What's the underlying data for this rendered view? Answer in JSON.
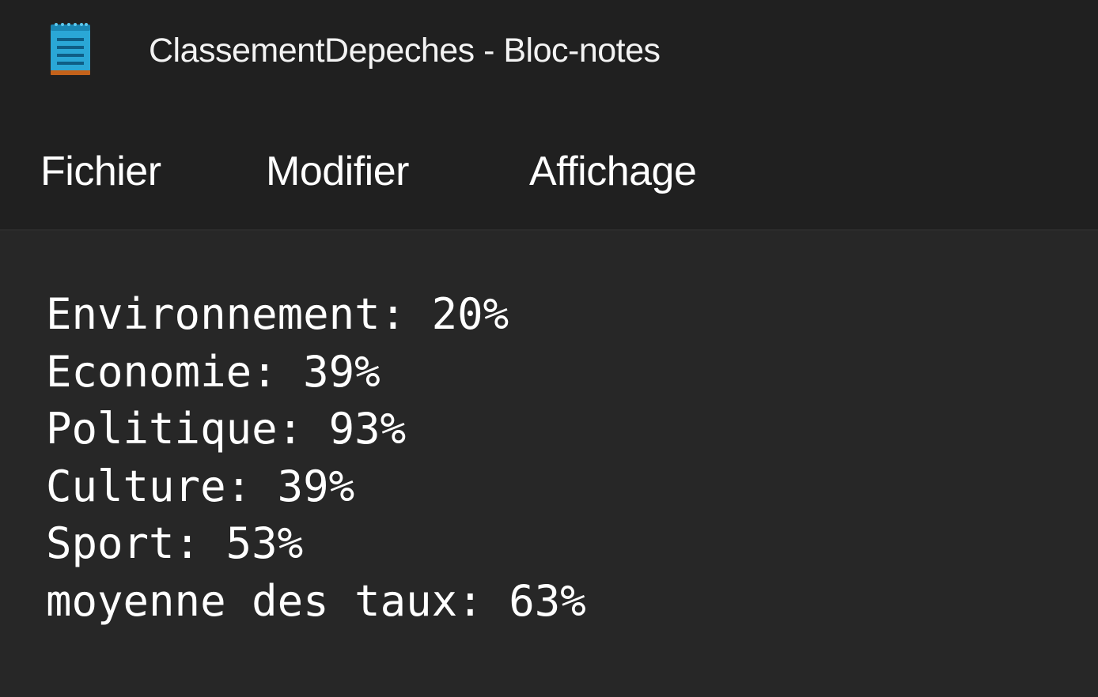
{
  "window": {
    "title": "ClassementDepeches - Bloc-notes",
    "app_icon": "notepad-icon"
  },
  "menu": {
    "items": [
      {
        "label": "Fichier"
      },
      {
        "label": "Modifier"
      },
      {
        "label": "Affichage"
      }
    ]
  },
  "document": {
    "lines": [
      "Environnement: 20%",
      "Economie: 39%",
      "Politique: 93%",
      "Culture: 39%",
      "Sport: 53%",
      "moyenne des taux: 63%"
    ]
  },
  "colors": {
    "background": "#272727",
    "chrome": "#202020",
    "text": "#ffffff",
    "icon_accent": "#2aa7d6"
  }
}
